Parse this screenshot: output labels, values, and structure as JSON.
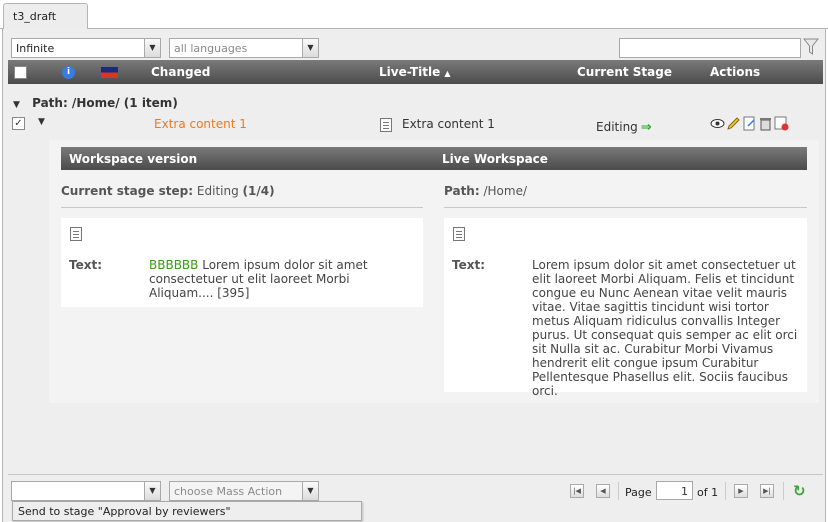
{
  "tab": {
    "label": "t3_draft"
  },
  "filters": {
    "depth": "Infinite",
    "language": "all languages",
    "search_value": ""
  },
  "grid": {
    "columns": {
      "changed": "Changed",
      "live_title": "Live-Title",
      "stage": "Current Stage",
      "actions": "Actions"
    },
    "sort_indicator": "▲",
    "group_label": "Path: /Home/ (1 item)",
    "row": {
      "changed": "Extra content 1",
      "live_title": "Extra content 1",
      "stage": "Editing",
      "actions": [
        "preview-icon",
        "edit-icon",
        "open-page-icon",
        "discard-icon",
        "history-icon"
      ]
    }
  },
  "detail": {
    "left_header": "Workspace version",
    "right_header": "Live Workspace",
    "stage_step_label": "Current stage step:",
    "stage_step_name": "Editing",
    "stage_step_open": "(",
    "stage_step_count": "1/4",
    "stage_step_close": ")",
    "path_label": "Path:",
    "path_value": "/Home/",
    "text_label": "Text:",
    "left_text_inserted": "BBBBBB",
    "left_text": " Lorem ipsum dolor sit amet consectetuer ut elit laoreet Morbi Aliquam.... [395]",
    "right_text": "Lorem ipsum dolor sit amet consectetuer ut elit laoreet Morbi Aliquam. Felis et tincidunt congue eu Nunc Aenean vitae velit mauris vitae. Vitae sagittis tincidunt wisi tortor metus Aliquam ridiculus convallis Integer purus. Ut consequat quis semper ac elit orci sit Nulla sit ac. Curabitur Morbi Vivamus hendrerit elit congue ipsum Curabitur Pellentesque Phasellus elit. Sociis faucibus orci."
  },
  "bottom": {
    "stage_select_value": "",
    "mass_action_placeholder": "choose Mass Action",
    "page_label": "Page",
    "page_value": "1",
    "of_label": "of 1",
    "tooltip": "Send to stage \"Approval by reviewers\""
  }
}
